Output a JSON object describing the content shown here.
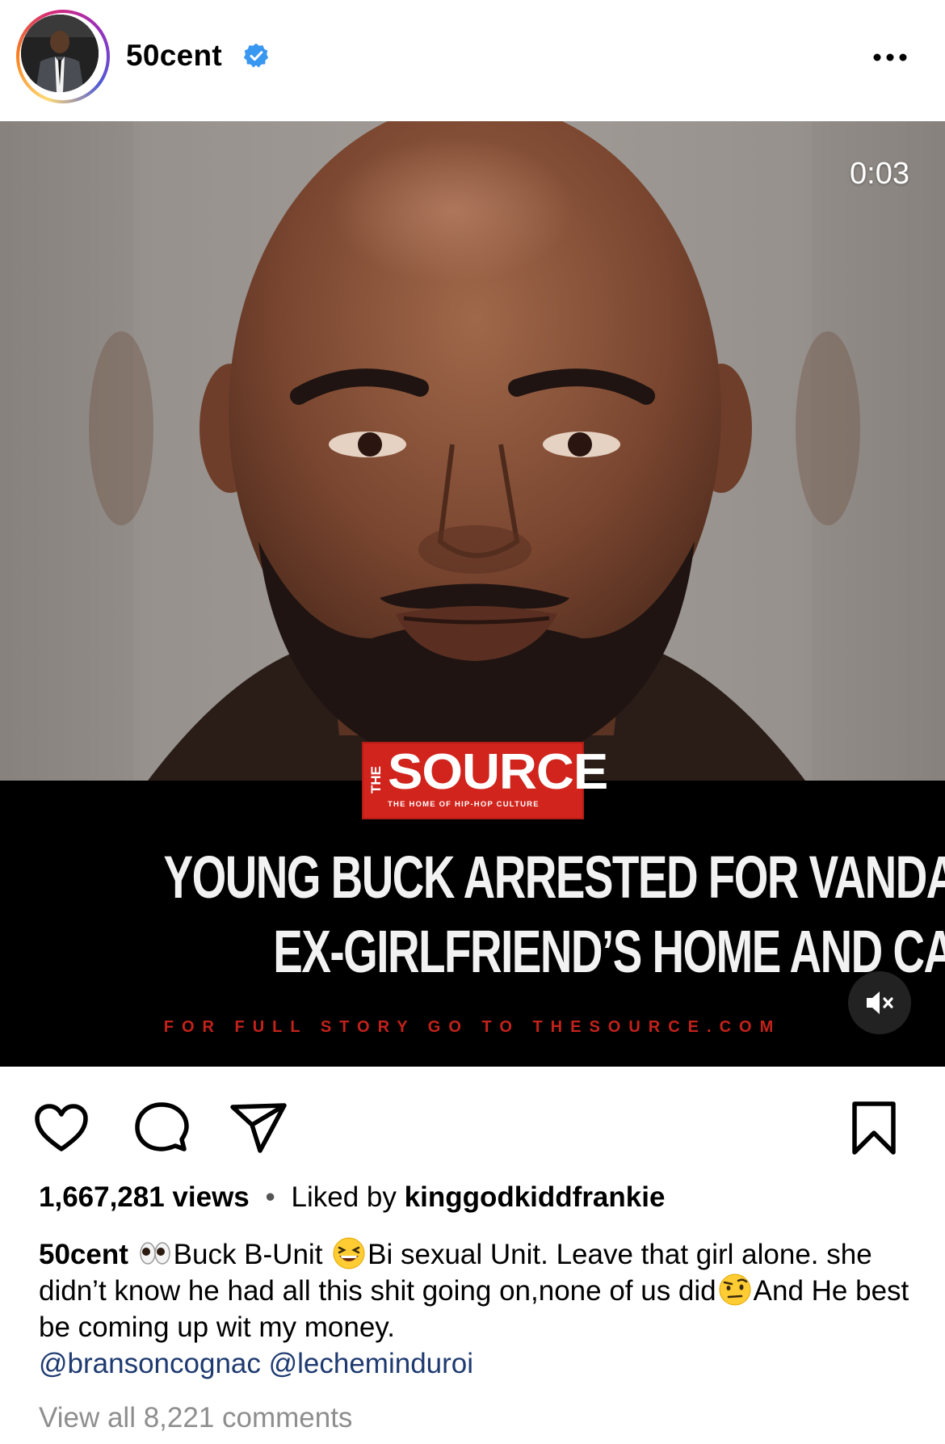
{
  "post": {
    "username": "50cent",
    "verified": true,
    "video_time": "0:03",
    "views": "1,667,281 views",
    "separator": "•",
    "liked_by_prefix": "Liked by",
    "liked_by_user": "kinggodkiddfrankie",
    "caption_user": "50cent",
    "caption_part1": "Buck B-Unit",
    "caption_part2": "Bi sexual Unit. Leave that girl alone. she didn’t know he had all this shit going on,none of us did",
    "caption_part3": "And He best be coming up wit my money.",
    "mentions": [
      "@bransoncognac",
      "@lecheminduroi"
    ],
    "view_all_comments": "View all 8,221 comments"
  },
  "video_overlay": {
    "logo_the": "THE",
    "logo_word": "SOURCE",
    "logo_tagline": "THE HOME OF HIP-HOP CULTURE",
    "headline_line1": "YOUNG BUCK ARRESTED FOR VANDALIZING",
    "headline_line2": "EX-GIRLFRIEND’S HOME AND CAR",
    "footer": "FOR FULL STORY GO TO THESOURCE.COM"
  },
  "icons": {
    "more": "more-options-icon",
    "verified": "verified-badge-icon",
    "mute": "speaker-muted-icon",
    "like": "heart-icon",
    "comment": "comment-bubble-icon",
    "share": "paper-plane-icon",
    "save": "bookmark-icon"
  },
  "colors": {
    "verified_blue": "#3897f0",
    "source_red": "#d0241d",
    "mention_blue": "#1e3a70",
    "muted_text": "#8e8e8e"
  }
}
